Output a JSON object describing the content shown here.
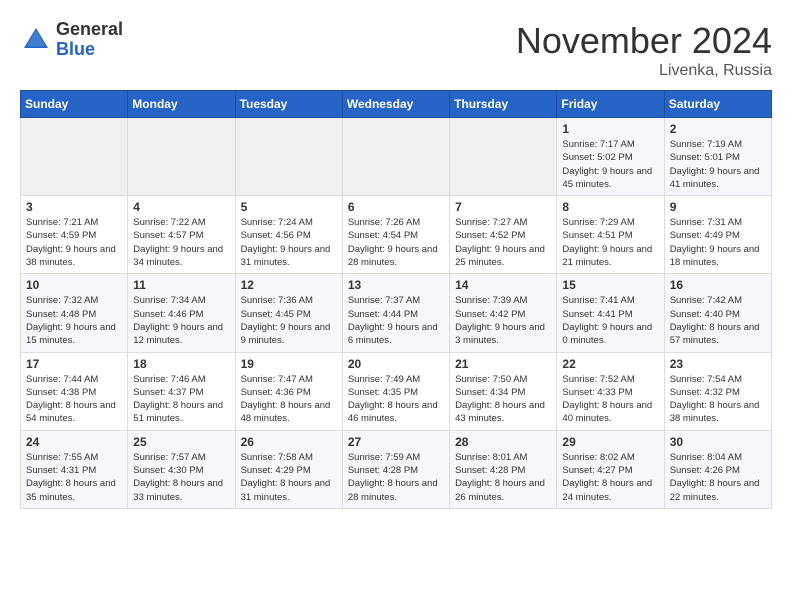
{
  "header": {
    "logo_general": "General",
    "logo_blue": "Blue",
    "month_title": "November 2024",
    "location": "Livenka, Russia"
  },
  "weekdays": [
    "Sunday",
    "Monday",
    "Tuesday",
    "Wednesday",
    "Thursday",
    "Friday",
    "Saturday"
  ],
  "weeks": [
    [
      {
        "day": "",
        "empty": true
      },
      {
        "day": "",
        "empty": true
      },
      {
        "day": "",
        "empty": true
      },
      {
        "day": "",
        "empty": true
      },
      {
        "day": "",
        "empty": true
      },
      {
        "day": "1",
        "sunrise": "Sunrise: 7:17 AM",
        "sunset": "Sunset: 5:02 PM",
        "daylight": "Daylight: 9 hours and 45 minutes."
      },
      {
        "day": "2",
        "sunrise": "Sunrise: 7:19 AM",
        "sunset": "Sunset: 5:01 PM",
        "daylight": "Daylight: 9 hours and 41 minutes."
      }
    ],
    [
      {
        "day": "3",
        "sunrise": "Sunrise: 7:21 AM",
        "sunset": "Sunset: 4:59 PM",
        "daylight": "Daylight: 9 hours and 38 minutes."
      },
      {
        "day": "4",
        "sunrise": "Sunrise: 7:22 AM",
        "sunset": "Sunset: 4:57 PM",
        "daylight": "Daylight: 9 hours and 34 minutes."
      },
      {
        "day": "5",
        "sunrise": "Sunrise: 7:24 AM",
        "sunset": "Sunset: 4:56 PM",
        "daylight": "Daylight: 9 hours and 31 minutes."
      },
      {
        "day": "6",
        "sunrise": "Sunrise: 7:26 AM",
        "sunset": "Sunset: 4:54 PM",
        "daylight": "Daylight: 9 hours and 28 minutes."
      },
      {
        "day": "7",
        "sunrise": "Sunrise: 7:27 AM",
        "sunset": "Sunset: 4:52 PM",
        "daylight": "Daylight: 9 hours and 25 minutes."
      },
      {
        "day": "8",
        "sunrise": "Sunrise: 7:29 AM",
        "sunset": "Sunset: 4:51 PM",
        "daylight": "Daylight: 9 hours and 21 minutes."
      },
      {
        "day": "9",
        "sunrise": "Sunrise: 7:31 AM",
        "sunset": "Sunset: 4:49 PM",
        "daylight": "Daylight: 9 hours and 18 minutes."
      }
    ],
    [
      {
        "day": "10",
        "sunrise": "Sunrise: 7:32 AM",
        "sunset": "Sunset: 4:48 PM",
        "daylight": "Daylight: 9 hours and 15 minutes."
      },
      {
        "day": "11",
        "sunrise": "Sunrise: 7:34 AM",
        "sunset": "Sunset: 4:46 PM",
        "daylight": "Daylight: 9 hours and 12 minutes."
      },
      {
        "day": "12",
        "sunrise": "Sunrise: 7:36 AM",
        "sunset": "Sunset: 4:45 PM",
        "daylight": "Daylight: 9 hours and 9 minutes."
      },
      {
        "day": "13",
        "sunrise": "Sunrise: 7:37 AM",
        "sunset": "Sunset: 4:44 PM",
        "daylight": "Daylight: 9 hours and 6 minutes."
      },
      {
        "day": "14",
        "sunrise": "Sunrise: 7:39 AM",
        "sunset": "Sunset: 4:42 PM",
        "daylight": "Daylight: 9 hours and 3 minutes."
      },
      {
        "day": "15",
        "sunrise": "Sunrise: 7:41 AM",
        "sunset": "Sunset: 4:41 PM",
        "daylight": "Daylight: 9 hours and 0 minutes."
      },
      {
        "day": "16",
        "sunrise": "Sunrise: 7:42 AM",
        "sunset": "Sunset: 4:40 PM",
        "daylight": "Daylight: 8 hours and 57 minutes."
      }
    ],
    [
      {
        "day": "17",
        "sunrise": "Sunrise: 7:44 AM",
        "sunset": "Sunset: 4:38 PM",
        "daylight": "Daylight: 8 hours and 54 minutes."
      },
      {
        "day": "18",
        "sunrise": "Sunrise: 7:46 AM",
        "sunset": "Sunset: 4:37 PM",
        "daylight": "Daylight: 8 hours and 51 minutes."
      },
      {
        "day": "19",
        "sunrise": "Sunrise: 7:47 AM",
        "sunset": "Sunset: 4:36 PM",
        "daylight": "Daylight: 8 hours and 48 minutes."
      },
      {
        "day": "20",
        "sunrise": "Sunrise: 7:49 AM",
        "sunset": "Sunset: 4:35 PM",
        "daylight": "Daylight: 8 hours and 46 minutes."
      },
      {
        "day": "21",
        "sunrise": "Sunrise: 7:50 AM",
        "sunset": "Sunset: 4:34 PM",
        "daylight": "Daylight: 8 hours and 43 minutes."
      },
      {
        "day": "22",
        "sunrise": "Sunrise: 7:52 AM",
        "sunset": "Sunset: 4:33 PM",
        "daylight": "Daylight: 8 hours and 40 minutes."
      },
      {
        "day": "23",
        "sunrise": "Sunrise: 7:54 AM",
        "sunset": "Sunset: 4:32 PM",
        "daylight": "Daylight: 8 hours and 38 minutes."
      }
    ],
    [
      {
        "day": "24",
        "sunrise": "Sunrise: 7:55 AM",
        "sunset": "Sunset: 4:31 PM",
        "daylight": "Daylight: 8 hours and 35 minutes."
      },
      {
        "day": "25",
        "sunrise": "Sunrise: 7:57 AM",
        "sunset": "Sunset: 4:30 PM",
        "daylight": "Daylight: 8 hours and 33 minutes."
      },
      {
        "day": "26",
        "sunrise": "Sunrise: 7:58 AM",
        "sunset": "Sunset: 4:29 PM",
        "daylight": "Daylight: 8 hours and 31 minutes."
      },
      {
        "day": "27",
        "sunrise": "Sunrise: 7:59 AM",
        "sunset": "Sunset: 4:28 PM",
        "daylight": "Daylight: 8 hours and 28 minutes."
      },
      {
        "day": "28",
        "sunrise": "Sunrise: 8:01 AM",
        "sunset": "Sunset: 4:28 PM",
        "daylight": "Daylight: 8 hours and 26 minutes."
      },
      {
        "day": "29",
        "sunrise": "Sunrise: 8:02 AM",
        "sunset": "Sunset: 4:27 PM",
        "daylight": "Daylight: 8 hours and 24 minutes."
      },
      {
        "day": "30",
        "sunrise": "Sunrise: 8:04 AM",
        "sunset": "Sunset: 4:26 PM",
        "daylight": "Daylight: 8 hours and 22 minutes."
      }
    ]
  ]
}
